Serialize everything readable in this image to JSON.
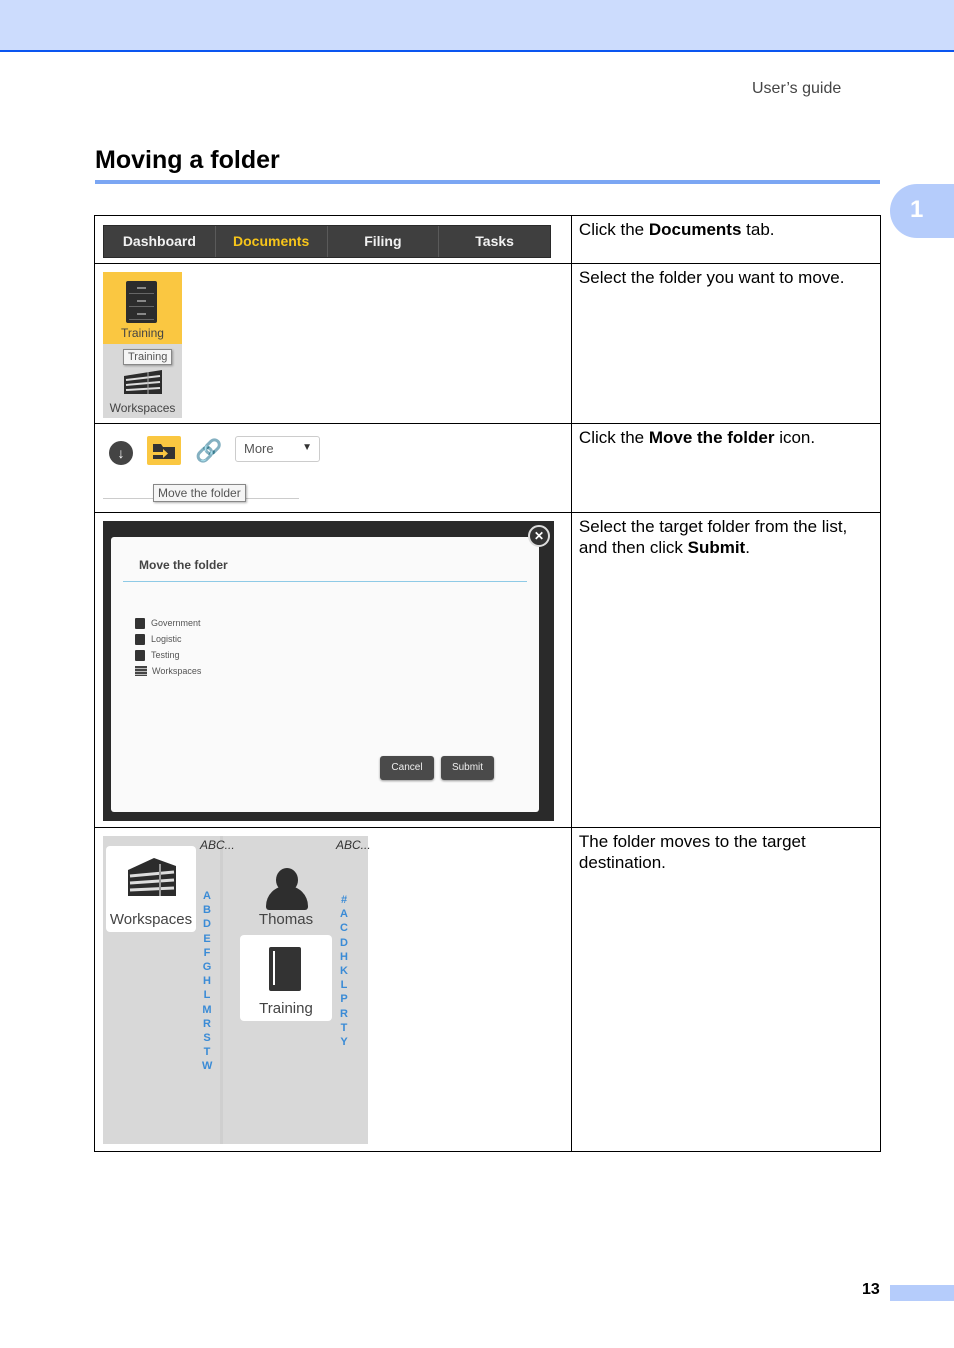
{
  "header": {
    "guide_label": "User’s guide",
    "band_color": "#ccdcfd",
    "rule_color": "#0a55f0"
  },
  "page_title": "Moving a folder",
  "chapter_tab": "1",
  "steps": [
    {
      "text_before": "Click the ",
      "text_bold": "Documents",
      "text_after": " tab.",
      "nav_tabs": [
        {
          "label": "Dashboard",
          "active": false
        },
        {
          "label": "Documents",
          "active": true
        },
        {
          "label": "Filing",
          "active": false
        },
        {
          "label": "Tasks",
          "active": false
        }
      ]
    },
    {
      "text": "Select the folder you want to move.",
      "selected_folder": "Training",
      "tooltip": "Training",
      "other_folder": "Workspaces"
    },
    {
      "text_before": "Click the ",
      "text_bold": "Move the folder",
      "text_after": " icon.",
      "more_label": "More",
      "tooltip": "Move the folder"
    },
    {
      "text_before": "Select the target folder from the list, and then click ",
      "text_bold": "Submit",
      "text_after": ".",
      "dialog_title": "Move the folder",
      "folders": [
        "Government",
        "Logistic",
        "Testing",
        "Workspaces"
      ],
      "cancel_label": "Cancel",
      "submit_label": "Submit"
    },
    {
      "text": "The folder moves to the target destination.",
      "left_card": "Workspaces",
      "right_items": [
        "Thomas",
        "Training"
      ],
      "sort_label": "ABC...",
      "left_index": [
        "A",
        "B",
        "D",
        "E",
        "F",
        "G",
        "H",
        "L",
        "M",
        "R",
        "S",
        "T",
        "W"
      ],
      "right_index": [
        "#",
        "A",
        "C",
        "D",
        "H",
        "K",
        "L",
        "P",
        "R",
        "T",
        "Y"
      ]
    }
  ],
  "footer": {
    "page_number": "13"
  },
  "accent_colors": {
    "yellow": "#fac741",
    "index_blue": "#3a8bd6",
    "title_rule": "#7ba6f3"
  }
}
